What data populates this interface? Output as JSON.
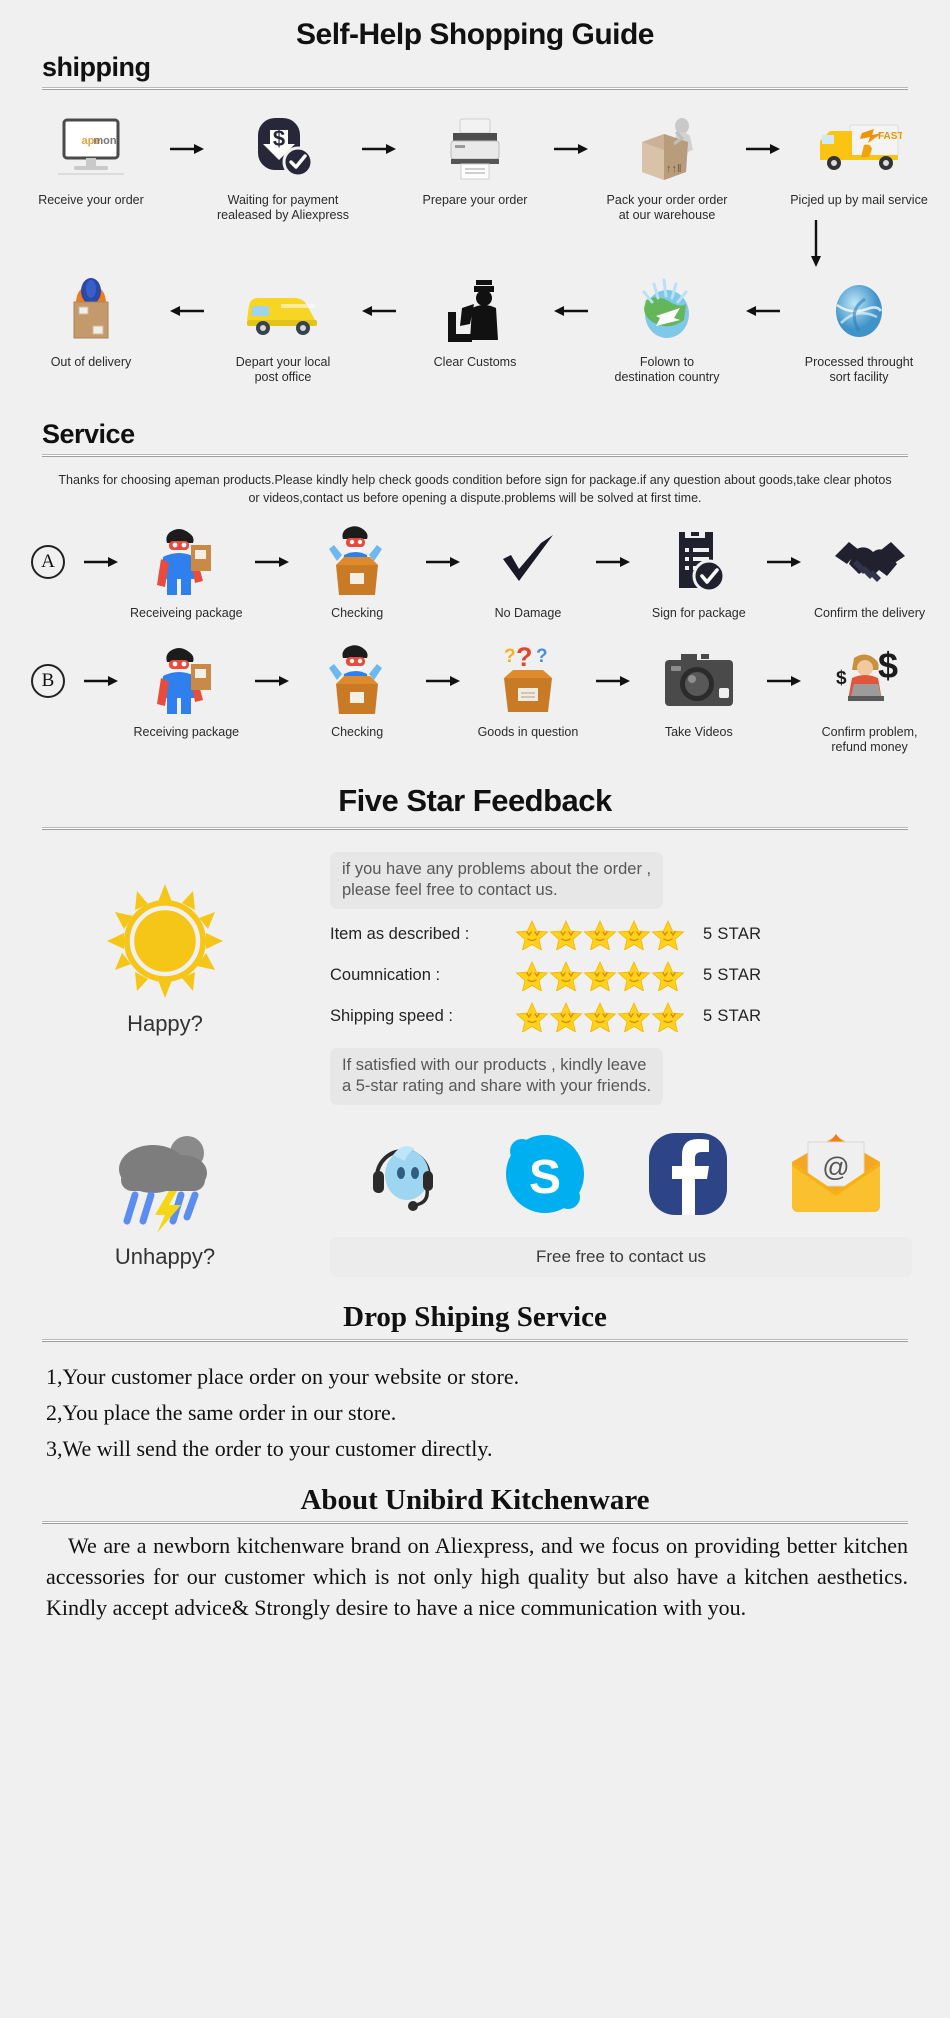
{
  "page": {
    "title": "Self-Help Shopping Guide",
    "background": "#f0f0f0"
  },
  "shipping": {
    "heading": "shipping",
    "row1": [
      {
        "icon": "monitor-apeman-icon",
        "caption": "Receive your order"
      },
      {
        "icon": "payment-dollar-shield-icon",
        "caption": "Waiting for payment\nrealeased by Aliexpress"
      },
      {
        "icon": "printer-icon",
        "caption": "Prepare your order"
      },
      {
        "icon": "worker-packing-box-icon",
        "caption": "Pack your order order\nat our warehouse"
      },
      {
        "icon": "fast-delivery-truck-icon",
        "caption": "Picjed up by mail service"
      }
    ],
    "row2": [
      {
        "icon": "delivery-man-box-icon",
        "caption": "Out of delivery"
      },
      {
        "icon": "yellow-post-van-icon",
        "caption": "Depart your local\npost office"
      },
      {
        "icon": "customs-officer-icon",
        "caption": "Clear Customs"
      },
      {
        "icon": "globe-airplane-icon",
        "caption": "Folown to\ndestination country"
      },
      {
        "icon": "blue-globe-sort-icon",
        "caption": "Processed throught\nsort facility"
      }
    ]
  },
  "service": {
    "heading": "Service",
    "intro": "Thanks for choosing apeman products.Please kindly help check goods condition before sign for package.if any question about goods,take clear photos or videos,contact us before opening a dispute.problems will be solved at first time.",
    "rowA": {
      "badge": "A",
      "steps": [
        {
          "icon": "hero-holding-package-icon",
          "caption": "Receiveing package"
        },
        {
          "icon": "hero-opening-box-icon",
          "caption": "Checking"
        },
        {
          "icon": "checkmark-icon",
          "caption": "No Damage"
        },
        {
          "icon": "signed-document-icon",
          "caption": "Sign for package"
        },
        {
          "icon": "handshake-icon",
          "caption": "Confirm the delivery"
        }
      ]
    },
    "rowB": {
      "badge": "B",
      "steps": [
        {
          "icon": "hero-holding-package-icon",
          "caption": "Receiving package"
        },
        {
          "icon": "hero-opening-box-icon",
          "caption": "Checking"
        },
        {
          "icon": "box-question-marks-icon",
          "caption": "Goods in question"
        },
        {
          "icon": "camera-icon",
          "caption": "Take Videos"
        },
        {
          "icon": "agent-refund-dollar-icon",
          "caption": "Confirm problem,\nrefund money"
        }
      ]
    }
  },
  "feedback": {
    "heading": "Five Star Feedback",
    "top_bubble": "if you have any problems about the order ,\nplease feel free to contact us.",
    "happy_label": "Happy?",
    "happy_icon": "sun-icon",
    "ratings": [
      {
        "label": "Item as described :",
        "stars": 5,
        "value": "5 STAR"
      },
      {
        "label": "Coumnication :",
        "stars": 5,
        "value": "5 STAR"
      },
      {
        "label": "Shipping speed :",
        "stars": 5,
        "value": "5 STAR"
      }
    ],
    "bottom_bubble": "If satisfied with our products ,  kindly leave\na 5-star rating and share with your friends.",
    "unhappy_label": "Unhappy?",
    "unhappy_icon": "storm-cloud-icon",
    "contact_icons": [
      "trademanager-headset-icon",
      "skype-icon",
      "facebook-icon",
      "email-envelope-icon"
    ],
    "contact_button": "Free free to contact us",
    "star_color": "#FFD21E",
    "sun_color": "#F5C518"
  },
  "dropshipping": {
    "heading": "Drop Shiping Service",
    "items": [
      "1,Your customer place order on your website or store.",
      "2,You place the same order in our store.",
      "3,We will send the order to your customer directly."
    ]
  },
  "about": {
    "heading": "About Unibird Kitchenware",
    "body": "We are a newborn kitchenware brand on Aliexpress, and we focus on providing better kitchen accessories for our customer which is not only high quality but also have a kitchen aesthetics. Kindly accept advice& Strongly desire to have a nice communication with you."
  }
}
